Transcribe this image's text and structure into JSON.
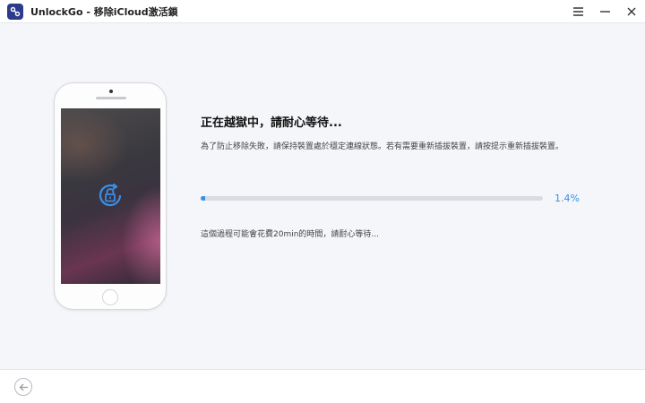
{
  "window": {
    "title": "UnlockGo - 移除iCloud激活鎖",
    "logo_icon": "unlockgo-logo-icon",
    "menu_icon": "hamburger-menu-icon",
    "minimize_icon": "minimize-icon",
    "close_icon": "close-icon"
  },
  "main": {
    "title": "正在越獄中，請耐心等待...",
    "description": "為了防止移除失敗，請保持裝置處於穩定連線狀態。若有需要重新插拔裝置，請按提示重新插拔裝置。",
    "progress": {
      "percent": 1.4,
      "label": "1.4%"
    },
    "note": "這個過程可能會花費20min的時間，請耐心等待..."
  },
  "phone": {
    "screen_icon": "lock-rotate-icon"
  },
  "footer": {
    "back_icon": "back-arrow-icon"
  },
  "colors": {
    "accent": "#3b8ee8",
    "logo_bg": "#2d3a8c",
    "track": "#dadbe0"
  }
}
